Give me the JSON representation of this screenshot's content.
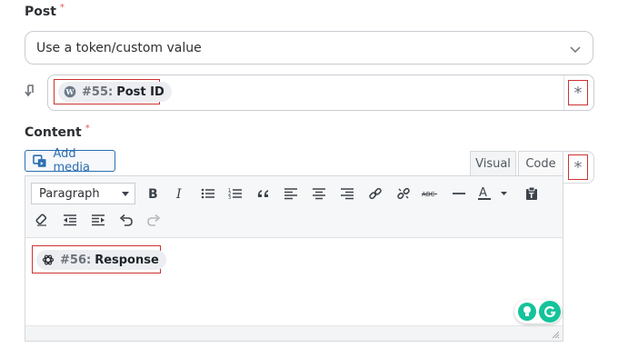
{
  "post": {
    "label": "Post",
    "required_mark": "*",
    "select_value": "Use a token/custom value",
    "token": {
      "number": "#55:",
      "name": "Post ID",
      "icon": "wordpress-icon"
    },
    "custom_toggle": "*"
  },
  "content": {
    "label": "Content",
    "required_mark": "*",
    "add_media_label": "Add media",
    "tabs": {
      "visual": "Visual",
      "code": "Code"
    },
    "custom_toggle": "*",
    "format_select": "Paragraph",
    "toolbar_icons": [
      "bold-icon",
      "italic-icon",
      "bullet-list-icon",
      "numbered-list-icon",
      "blockquote-icon",
      "align-left-icon",
      "align-center-icon",
      "align-right-icon",
      "link-icon",
      "unlink-icon",
      "strikethrough-icon",
      "horizontal-line-icon",
      "text-color-icon",
      "paste-text-icon",
      "clear-formatting-icon",
      "outdent-icon",
      "indent-icon",
      "undo-icon",
      "redo-icon"
    ],
    "token": {
      "number": "#56:",
      "name": "Response",
      "icon": "openai-icon"
    }
  },
  "colors": {
    "highlight_box": "#cc3333",
    "link_blue": "#2b6fb0",
    "grammarly_green": "#15c39a"
  }
}
